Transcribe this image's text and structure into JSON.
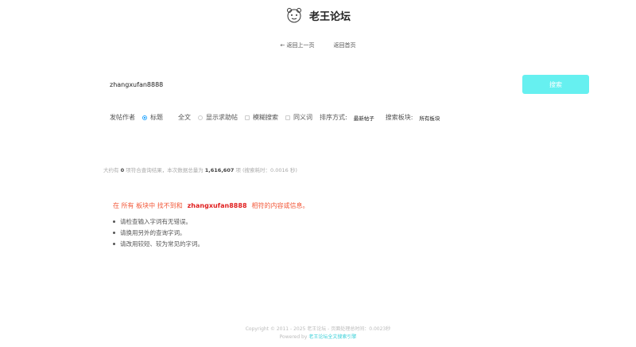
{
  "header": {
    "site_title": "老王论坛",
    "logo_icon": "bear-mascot-icon"
  },
  "nav": {
    "back_label": "← 返回上一页",
    "home_label": "返回首页"
  },
  "search": {
    "query": "zhangxufan8888",
    "button_label": "搜索",
    "button_color": "#66f0f0"
  },
  "options": {
    "author_label": "发帖作者",
    "title_label": "标题",
    "fulltext_label": "全文",
    "help_posts_label": "显示求助帖",
    "fuzzy_label": "模糊搜索",
    "synonym_label": "同义词",
    "sort_label": "排序方式:",
    "sort_value": "最新帖子",
    "board_label": "搜索板块:",
    "board_value": "所有板块",
    "selected": "标题"
  },
  "stats": {
    "prefix": "大约有",
    "count": "0",
    "middle": "项符合查询结果，本次数据总量为",
    "total": "1,616,607",
    "suffix": "项 (搜索耗时：0.0016 秒)"
  },
  "no_result": {
    "prefix": "在 所有 板块中 找不到和",
    "keyword": "zhangxufan8888",
    "suffix": "相符的内容或信息。",
    "color": "#f25a3b"
  },
  "tips": [
    "请检查输入字词有无错误。",
    "请换用另外的查询字词。",
    "请改用较短、较为常见的字词。"
  ],
  "footer": {
    "copyright": "Copyright © 2011 - 2025 老王论坛 - 页面处理总时间：0.0023秒",
    "powered_prefix": "Powered by",
    "powered_link": "老王论坛全文搜索引擎"
  }
}
